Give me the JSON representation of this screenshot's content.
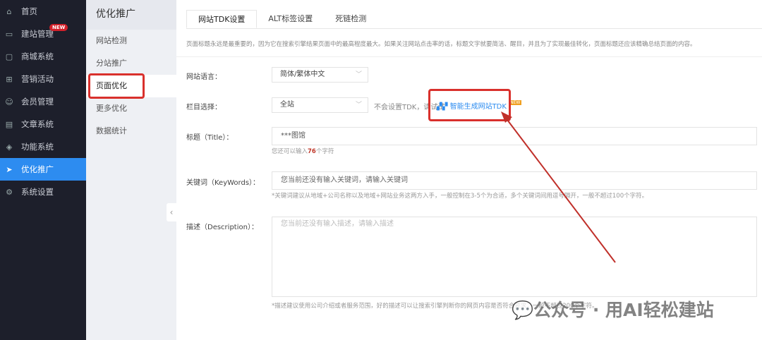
{
  "sidebar": {
    "items": [
      {
        "label": "首页",
        "icon": "home-icon"
      },
      {
        "label": "建站管理",
        "icon": "monitor-icon",
        "badge": "NEW"
      },
      {
        "label": "商城系统",
        "icon": "shop-icon"
      },
      {
        "label": "营销活动",
        "icon": "gift-icon"
      },
      {
        "label": "会员管理",
        "icon": "users-icon"
      },
      {
        "label": "文章系统",
        "icon": "document-icon"
      },
      {
        "label": "功能系统",
        "icon": "cube-icon"
      },
      {
        "label": "优化推广",
        "icon": "send-icon",
        "active": true
      },
      {
        "label": "系统设置",
        "icon": "gear-icon"
      }
    ]
  },
  "submenu": {
    "title": "优化推广",
    "items": [
      "网站检测",
      "分站推广",
      "页面优化",
      "更多优化",
      "数据统计"
    ]
  },
  "tabs": [
    "网站TDK设置",
    "ALT标签设置",
    "死链检测"
  ],
  "description": "页面标题永远是最重要的，因为它在搜索引擎结果页面中的最高程度最大。如果关注网站点击率的话，标题文字就要简洁、醒目，并且为了实现最佳转化，页面标题还应该精确总结页面的内容。",
  "form": {
    "language": {
      "label": "网站语言：",
      "value": "简体/繁体中文"
    },
    "column": {
      "label": "栏目选择：",
      "value": "全站",
      "tip": "不会设置TDK，请试试",
      "generate_link": "智能生成网站TDK",
      "new_badge": "NEW"
    },
    "title": {
      "label": "标题（Title）：",
      "value": "***图馆",
      "hint_prefix": "您还可以输入",
      "remaining": "76",
      "hint_suffix": "个字符"
    },
    "keywords": {
      "label": "关键词（KeyWords）：",
      "placeholder": "您当前还没有输入关键词，请输入关键词",
      "hint": "*关键词建议从地域+公司名称以及地域+网站业务这两方入手，一般控制在3-5个为合适，多个关键词间用逗号隔开，一般不超过100个字符。"
    },
    "descr": {
      "label": "描述（Description）：",
      "placeholder": "您当前还没有输入描述，请输入描述",
      "hint": "*描述建议使用公司介绍或者服务范围，好的描述可以让搜索引擎判断你的网页内容是否符合要求，一般不超过200个字符。"
    }
  },
  "watermark": "公众号 · 用AI轻松建站"
}
